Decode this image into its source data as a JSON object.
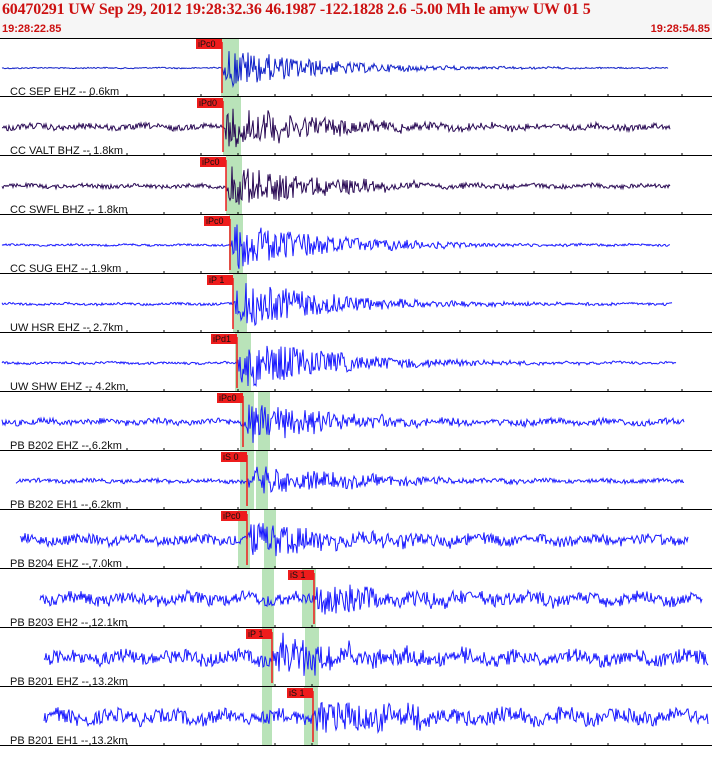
{
  "header": {
    "title": "60470291 UW Sep 29, 2012 19:28:32.36   46.1987 -122.1828  2.6 -5.00 Mh le amyw UW 01   5",
    "start_time": "19:28:22.85",
    "end_time": "19:28:54.85"
  },
  "colors": {
    "title": "#cc1111",
    "trace_blue": "#1a1aff",
    "trace_dark": "#2a0a55",
    "pick_box": "#ee1c1c",
    "window": "#b9e3b9"
  },
  "traces": [
    {
      "label": "CC SEP EHZ -- 0.6km",
      "pick": "iPc0",
      "color": "dark_blue"
    },
    {
      "label": "CC VALT BHZ -- 1.8km",
      "pick": "iPd0",
      "color": "purple"
    },
    {
      "label": "CC SWFL BHZ -- 1.8km",
      "pick": "iPc0",
      "color": "purple"
    },
    {
      "label": "CC SUG EHZ -- 1.9km",
      "pick": "iPc0",
      "color": "blue"
    },
    {
      "label": "UW HSR EHZ -- 2.7km",
      "pick": "iP 1",
      "color": "blue"
    },
    {
      "label": "UW SHW EHZ -- 4.2km",
      "pick": "iPd1",
      "color": "blue"
    },
    {
      "label": "PB B202 EHZ -- 6.2km",
      "pick": "iPc0",
      "color": "blue"
    },
    {
      "label": "PB B202 EH1 -- 6.2km",
      "pick": "iS 0",
      "color": "blue"
    },
    {
      "label": "PB B204 EHZ -- 7.0km",
      "pick": "iPc0",
      "color": "blue"
    },
    {
      "label": "PB B203 EH2 -- 12.1km",
      "pick": "iS 1",
      "color": "blue"
    },
    {
      "label": "PB B201 EHZ -- 13.2km",
      "pick": "iP 1",
      "color": "blue"
    },
    {
      "label": "PB B201 EH1 -- 13.2km",
      "pick": "iS 1",
      "color": "blue"
    }
  ]
}
